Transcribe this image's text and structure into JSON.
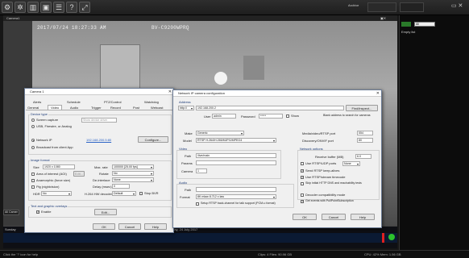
{
  "toolbar": {
    "buttons": [
      "gear-icon",
      "settings-icon",
      "chart-icon",
      "image-icon",
      "list-icon",
      "help-icon",
      "fullscreen-icon"
    ],
    "right_label": "Archive",
    "right_small": [
      "",
      "",
      "",
      ""
    ]
  },
  "camera": {
    "title": "Camera1",
    "timestamp": "2017/07/24 18:27:33 AM",
    "id_text": "BV-C9200WPRQ"
  },
  "side_panel": {
    "filter": "All",
    "empty": "Empty list",
    "top_labels": [
      "",
      ""
    ]
  },
  "timeline": {
    "date": "Thursday, 24 July 2017",
    "left_label": "Sunday",
    "all_label": "All Camer"
  },
  "status": {
    "left": "Click the '?' icon for help",
    "center": "Clips: 4 Files: 90.96 GB",
    "right": "CPU: 42% Mem: 1.56 GB"
  },
  "camera_dialog": {
    "title": "Camera 1",
    "tabs_top": [
      "Alerts",
      "Schedule",
      "PTZ/Control",
      "Watchdog"
    ],
    "tabs_bottom": [
      "General",
      "Video",
      "Audio",
      "Trigger",
      "Record",
      "Post",
      "Webcast"
    ],
    "device_type_label": "Device type",
    "radios": [
      "Screen capture",
      "USB, Firewire, or Analog",
      "Network IP",
      "Broadcast from client App"
    ],
    "screen_opt": "Show device driver",
    "network_link": "192.168.200.5:80",
    "configure_btn": "Configure...",
    "image_format_label": "Image format",
    "size_label": "Size",
    "size_val": "1920 x 1080",
    "max_rate_label": "Max. rate",
    "max_rate_val": "100000 [25.00 fps]",
    "area_label": "Area of interest (AOI)",
    "edit_btn": "Edit...",
    "rotate_label": "Rotate",
    "rotate_val": "No",
    "anamorphic_label": "Anamorphic (force size)",
    "deinterlace_label": "De-interlace",
    "deinterlace_val": "None",
    "pig_label": "Pig (nightvision)",
    "delay_label": "Delay (msec)",
    "delay_val": "0",
    "hdr_label": "HDR",
    "hdr_val": "No",
    "decoder_label": "H.264 HW decoder",
    "decoder_val": "Default",
    "stop_label": "Stop BVR",
    "text_overlays_label": "Text and graphic overlays",
    "enable_label": "Enable",
    "overlay_edit_btn": "Edit...",
    "ok": "OK",
    "cancel": "Cancel",
    "help": "Help"
  },
  "ipcam_dialog": {
    "title": "Network IP camera configuration",
    "address_label": "Address",
    "protocol": "http://",
    "address_val": "192.168.200.2",
    "find_btn": "Find/inspect...",
    "user_label": "User",
    "user_val": "admin",
    "password_label": "Password",
    "password_val": "*****",
    "show_label": "Show",
    "blank_hint": "Blank address to search for cameras",
    "make_label": "Make",
    "make_val": "Generic",
    "model_label": "Model",
    "model_val": "RTSP H.264/H.265/MJPG/MPEG4",
    "media_port_label": "Media/video/RTSP port",
    "media_port_val": "554",
    "discovery_port_label": "Discovery/ONVIF port",
    "discovery_port_val": "80",
    "video_label": "Video",
    "path_label": "Path",
    "path_val": "/live/main",
    "params_label": "Params",
    "camera_num_label": "Camera",
    "camera_num_val": "1",
    "network_options_label": "Network options",
    "receive_buffer_label": "Receive buffer (MB)",
    "receive_buffer_val": "6.0",
    "opts": [
      {
        "label": "Use RTSP/UDP ports",
        "on": false
      },
      {
        "label": "Send RTSP keep-alives",
        "on": true
      },
      {
        "label": "Use RTSP/stream timecode",
        "on": true
      },
      {
        "label": "Skip initial HTTP DNS and reachability tests",
        "on": false
      }
    ],
    "udp_val": "None",
    "audio_label": "Audio",
    "audio_path_label": "Path",
    "format_label": "Format",
    "format_val": "8K mlaw 8.712 x law",
    "decoder_compat_label": "Decoder compatibility mode",
    "get_events_label": "Get events with PullPointSubscription",
    "backchannel_label": "Setup RTSP back-channel for talk support (PCM-u format)",
    "ok": "OK",
    "cancel": "Cancel",
    "help": "Help"
  },
  "colors": {
    "accent": "#2b63c6",
    "title_blue": "#1e3c78",
    "dialog_bg": "#f0f0f0"
  }
}
